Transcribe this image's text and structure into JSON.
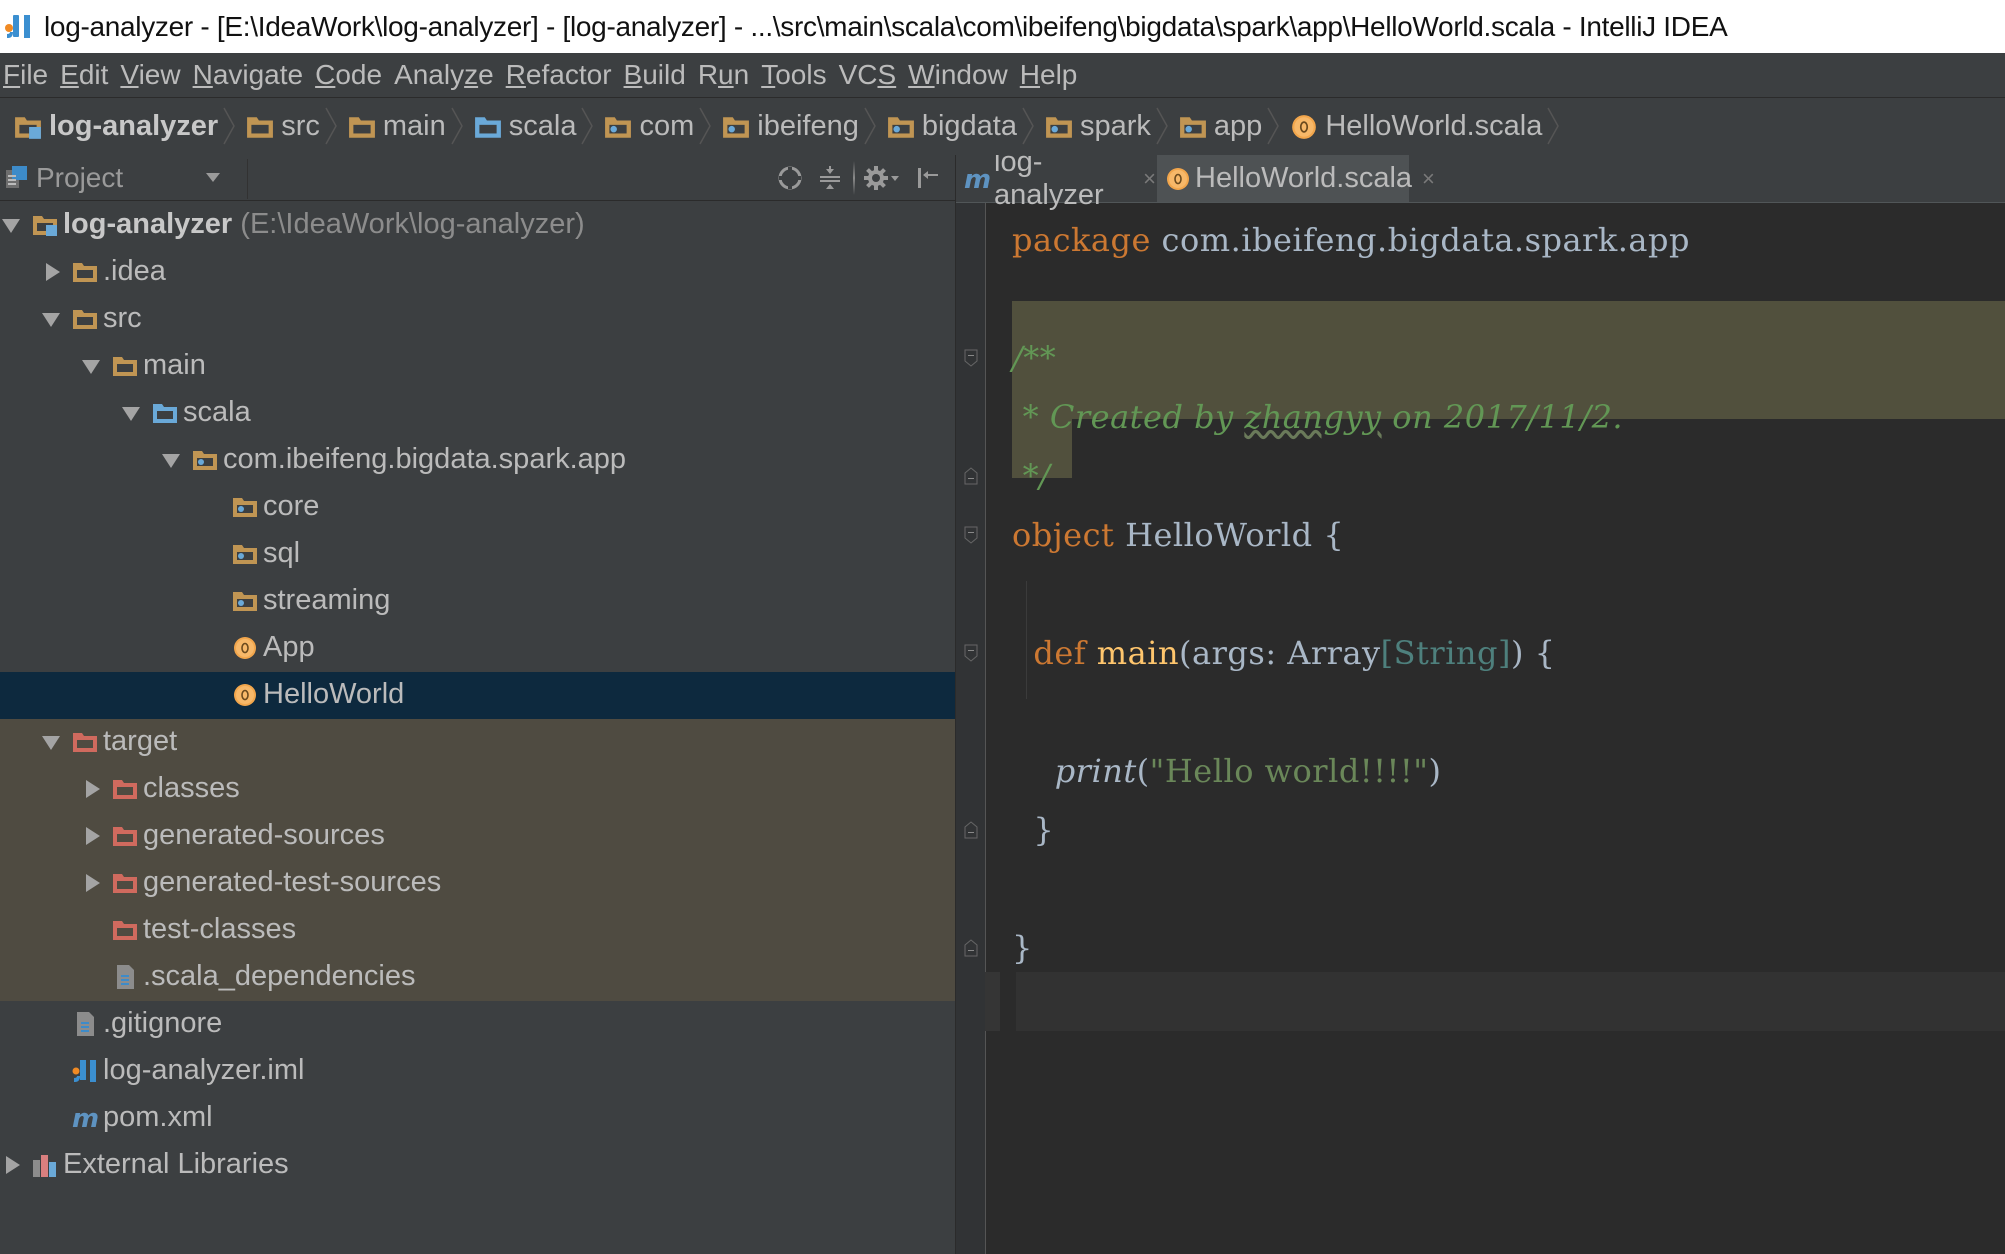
{
  "window": {
    "title": "log-analyzer - [E:\\IdeaWork\\log-analyzer] - [log-analyzer] - ...\\src\\main\\scala\\com\\ibeifeng\\bigdata\\spark\\app\\HelloWorld.scala - IntelliJ IDEA",
    "app_icon": "intellij-idea-icon"
  },
  "menu": [
    {
      "pre": "",
      "u": "F",
      "post": "ile"
    },
    {
      "pre": "",
      "u": "E",
      "post": "dit"
    },
    {
      "pre": "",
      "u": "V",
      "post": "iew"
    },
    {
      "pre": "",
      "u": "N",
      "post": "avigate"
    },
    {
      "pre": "",
      "u": "C",
      "post": "ode"
    },
    {
      "pre": "Analy",
      "u": "z",
      "post": "e"
    },
    {
      "pre": "",
      "u": "R",
      "post": "efactor"
    },
    {
      "pre": "",
      "u": "B",
      "post": "uild"
    },
    {
      "pre": "R",
      "u": "u",
      "post": "n"
    },
    {
      "pre": "",
      "u": "T",
      "post": "ools"
    },
    {
      "pre": "VC",
      "u": "S",
      "post": ""
    },
    {
      "pre": "",
      "u": "W",
      "post": "indow"
    },
    {
      "pre": "",
      "u": "H",
      "post": "elp"
    }
  ],
  "breadcrumb": [
    {
      "label": "log-analyzer",
      "icon": "module-folder-icon",
      "bold": true
    },
    {
      "label": "src",
      "icon": "folder-icon"
    },
    {
      "label": "main",
      "icon": "folder-icon"
    },
    {
      "label": "scala",
      "icon": "source-folder-icon"
    },
    {
      "label": "com",
      "icon": "package-icon"
    },
    {
      "label": "ibeifeng",
      "icon": "package-icon"
    },
    {
      "label": "bigdata",
      "icon": "package-icon"
    },
    {
      "label": "spark",
      "icon": "package-icon"
    },
    {
      "label": "app",
      "icon": "package-icon"
    },
    {
      "label": "HelloWorld.scala",
      "icon": "scala-object-icon"
    }
  ],
  "project_panel": {
    "title": "Project",
    "tools": [
      "scroll-from-source-icon",
      "collapse-all-icon",
      "settings-gear-icon",
      "hide-panel-icon"
    ],
    "tree": [
      {
        "label": "log-analyzer",
        "hint": "(E:\\IdeaWork\\log-analyzer)",
        "level": 0,
        "arrow": "down",
        "icon": "module-folder-icon",
        "bold": true
      },
      {
        "label": ".idea",
        "level": 1,
        "arrow": "right",
        "icon": "folder-icon"
      },
      {
        "label": "src",
        "level": 1,
        "arrow": "down",
        "icon": "folder-icon"
      },
      {
        "label": "main",
        "level": 2,
        "arrow": "down",
        "icon": "folder-icon"
      },
      {
        "label": "scala",
        "level": 3,
        "arrow": "down",
        "icon": "source-folder-icon"
      },
      {
        "label": "com.ibeifeng.bigdata.spark.app",
        "level": 4,
        "arrow": "down",
        "icon": "package-icon"
      },
      {
        "label": "core",
        "level": 5,
        "arrow": "",
        "icon": "package-icon"
      },
      {
        "label": "sql",
        "level": 5,
        "arrow": "",
        "icon": "package-icon"
      },
      {
        "label": "streaming",
        "level": 5,
        "arrow": "",
        "icon": "package-icon"
      },
      {
        "label": "App",
        "level": 5,
        "arrow": "",
        "icon": "scala-object-icon"
      },
      {
        "label": "HelloWorld",
        "level": 5,
        "arrow": "",
        "icon": "scala-object-icon",
        "selected": true
      },
      {
        "label": "target",
        "level": 1,
        "arrow": "down",
        "icon": "excluded-folder-icon",
        "excluded": true
      },
      {
        "label": "classes",
        "level": 2,
        "arrow": "right",
        "icon": "excluded-folder-icon",
        "excluded": true
      },
      {
        "label": "generated-sources",
        "level": 2,
        "arrow": "right",
        "icon": "excluded-folder-icon",
        "excluded": true
      },
      {
        "label": "generated-test-sources",
        "level": 2,
        "arrow": "right",
        "icon": "excluded-folder-icon",
        "excluded": true
      },
      {
        "label": "test-classes",
        "level": 2,
        "arrow": "",
        "icon": "excluded-folder-icon",
        "excluded": true
      },
      {
        "label": ".scala_dependencies",
        "level": 2,
        "arrow": "",
        "icon": "text-file-icon",
        "excluded": true
      },
      {
        "label": ".gitignore",
        "level": 1,
        "arrow": "",
        "icon": "text-file-icon"
      },
      {
        "label": "log-analyzer.iml",
        "level": 1,
        "arrow": "",
        "icon": "iml-file-icon"
      },
      {
        "label": "pom.xml",
        "level": 1,
        "arrow": "",
        "icon": "maven-icon"
      },
      {
        "label": "External Libraries",
        "level": 0,
        "arrow": "right",
        "icon": "libraries-icon"
      }
    ]
  },
  "editor": {
    "tabs": [
      {
        "label": "log-analyzer",
        "icon": "maven-icon",
        "active": false
      },
      {
        "label": "HelloWorld.scala",
        "icon": "scala-object-icon",
        "active": true
      }
    ],
    "lines": [
      [
        {
          "t": "package",
          "c": "kw"
        },
        {
          "t": " com.ibeifeng.bigdata.spark.app",
          "c": ""
        }
      ],
      [],
      [
        {
          "t": "/**",
          "c": "cm"
        }
      ],
      [
        {
          "t": " * Created by ",
          "c": "cm"
        },
        {
          "t": "zhangyy",
          "c": "cm"
        },
        {
          "t": " on 2017/11/2.",
          "c": "cm"
        }
      ],
      [
        {
          "t": " */",
          "c": "cm"
        }
      ],
      [
        {
          "t": "object",
          "c": "kw"
        },
        {
          "t": " HelloWorld {",
          "c": ""
        }
      ],
      [],
      [
        {
          "t": "  def ",
          "c": "kw"
        },
        {
          "t": "main",
          "c": "fn"
        },
        {
          "t": "(args: Array",
          "c": ""
        },
        {
          "t": "[String]",
          "c": "ty"
        },
        {
          "t": ") {",
          "c": ""
        }
      ],
      [],
      [
        {
          "t": "    ",
          "c": ""
        },
        {
          "t": "print",
          "c": "it"
        },
        {
          "t": "(",
          "c": ""
        },
        {
          "t": "\"Hello world!!!!\"",
          "c": "str"
        },
        {
          "t": ")",
          "c": ""
        }
      ],
      [
        {
          "t": "  }",
          "c": ""
        }
      ],
      [],
      [
        {
          "t": "}",
          "c": ""
        }
      ],
      []
    ],
    "caret_line": 14
  }
}
